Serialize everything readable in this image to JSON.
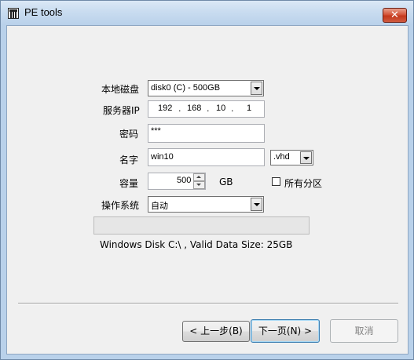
{
  "window": {
    "title": "PE tools",
    "icon": "toolbox-icon",
    "close_glyph": "✕"
  },
  "form": {
    "local_disk": {
      "label": "本地磁盘",
      "value": "disk0 (C) - 500GB"
    },
    "server_ip": {
      "label": "服务器IP",
      "octets": [
        "192",
        "168",
        "10",
        "1"
      ],
      "dots": [
        ".",
        ".",
        "."
      ]
    },
    "password": {
      "label": "密码",
      "value": "***"
    },
    "name": {
      "label": "名字",
      "value": "win10",
      "extension": ".vhd"
    },
    "capacity": {
      "label": "容量",
      "value": "500",
      "unit": "GB"
    },
    "all_partitions": {
      "label": "所有分区",
      "checked": false
    },
    "os": {
      "label": "操作系统",
      "value": "自动"
    }
  },
  "status": {
    "text": "Windows Disk C:\\ , Valid Data Size: 25GB",
    "progress": 0
  },
  "buttons": {
    "back": "< 上一步(B)",
    "next": "下一页(N) >",
    "cancel": "取消"
  }
}
